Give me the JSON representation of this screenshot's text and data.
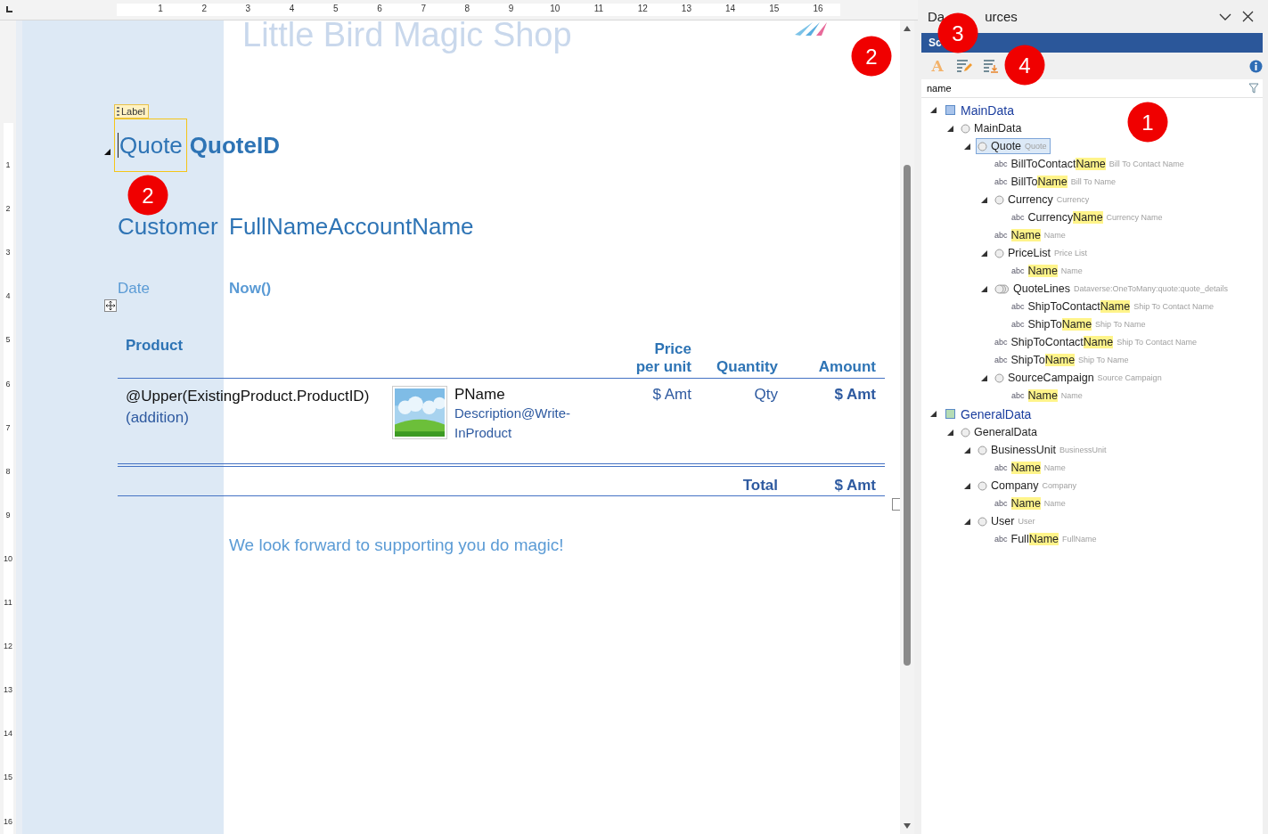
{
  "rulers": {
    "top_numbers": [
      "1",
      "2",
      "3",
      "4",
      "5",
      "6",
      "7",
      "8",
      "9",
      "10",
      "11",
      "12",
      "13",
      "14",
      "15",
      "16"
    ],
    "left_numbers": [
      "1",
      "2",
      "3",
      "4",
      "5",
      "6",
      "7",
      "8",
      "9",
      "10",
      "11",
      "12",
      "13",
      "14",
      "15",
      "16"
    ]
  },
  "document": {
    "banner": "Little Bird Magic Shop",
    "label_tag": "Label",
    "title_label": "Quote",
    "title_value": "QuoteID",
    "customer_label": "Customer",
    "customer_value": "FullNameAccountName",
    "date_label": "Date",
    "date_value": "Now()",
    "table": {
      "columns": [
        {
          "kind": "product",
          "label": "Product"
        },
        {
          "kind": "price",
          "label": "Price per unit"
        },
        {
          "kind": "quantity",
          "label": "Quantity"
        },
        {
          "kind": "amount",
          "label": "Amount"
        }
      ],
      "row": {
        "product": "@Upper(ExistingProduct.ProductID)",
        "addition": "(addition)",
        "name": "PName",
        "description": "Description@Write-InProduct",
        "price": "$ Amt",
        "quantity": "Qty",
        "amount": "$ Amt"
      },
      "total_label": "Total",
      "total_value": "$ Amt"
    },
    "footer": "We look forward to supporting you do magic!"
  },
  "panel": {
    "title_parts": [
      "Da",
      "urces"
    ],
    "tab_bar": "Sc",
    "toolbar": [
      {
        "kind": "font",
        "glyph": "A"
      },
      {
        "kind": "edit"
      },
      {
        "kind": "import"
      }
    ],
    "search": {
      "value": "name"
    },
    "tree": [
      {
        "kind": "source",
        "name": "MainData",
        "color": "#a9c4eb",
        "expanded": true,
        "selected": false,
        "children": [
          {
            "kind": "object",
            "name": "MainData",
            "expanded": true,
            "selected": false,
            "children": [
              {
                "kind": "object",
                "name": "Quote",
                "caption": "Quote",
                "expanded": true,
                "selected": true,
                "children": [
                  {
                    "kind": "field",
                    "type": "abc",
                    "name": "BillToContact",
                    "match": "Name",
                    "caption": "Bill To Contact Name",
                    "selected": false
                  },
                  {
                    "kind": "field",
                    "type": "abc",
                    "name": "BillTo",
                    "match": "Name",
                    "caption": "Bill To Name",
                    "selected": false
                  },
                  {
                    "kind": "object",
                    "name": "Currency",
                    "caption": "Currency",
                    "expanded": true,
                    "selected": false,
                    "children": [
                      {
                        "kind": "field",
                        "type": "abc",
                        "name": "Currency",
                        "match": "Name",
                        "caption": "Currency Name",
                        "selected": false
                      }
                    ]
                  },
                  {
                    "kind": "field",
                    "type": "abc",
                    "match": "Name",
                    "caption": "Name",
                    "selected": false
                  },
                  {
                    "kind": "object",
                    "name": "PriceList",
                    "caption": "Price List",
                    "expanded": true,
                    "selected": false,
                    "children": [
                      {
                        "kind": "field",
                        "type": "abc",
                        "match": "Name",
                        "caption": "Name",
                        "selected": false
                      }
                    ]
                  },
                  {
                    "kind": "collection",
                    "name": "QuoteLines",
                    "caption": "Dataverse:OneToMany:quote:quote_details",
                    "expanded": true,
                    "selected": false,
                    "children": [
                      {
                        "kind": "field",
                        "type": "abc",
                        "name": "ShipToContact",
                        "match": "Name",
                        "caption": "Ship To Contact Name",
                        "selected": false
                      },
                      {
                        "kind": "field",
                        "type": "abc",
                        "name": "ShipTo",
                        "match": "Name",
                        "caption": "Ship To Name",
                        "selected": false
                      }
                    ]
                  },
                  {
                    "kind": "field",
                    "type": "abc",
                    "name": "ShipToContact",
                    "match": "Name",
                    "caption": "Ship To Contact Name",
                    "selected": false
                  },
                  {
                    "kind": "field",
                    "type": "abc",
                    "name": "ShipTo",
                    "match": "Name",
                    "caption": "Ship To Name",
                    "selected": false
                  },
                  {
                    "kind": "object",
                    "name": "SourceCampaign",
                    "caption": "Source Campaign",
                    "expanded": true,
                    "selected": false,
                    "children": [
                      {
                        "kind": "field",
                        "type": "abc",
                        "match": "Name",
                        "caption": "Name",
                        "selected": false
                      }
                    ]
                  }
                ]
              }
            ]
          }
        ]
      },
      {
        "kind": "source",
        "name": "GeneralData",
        "color": "#b5dcb5",
        "expanded": true,
        "selected": false,
        "children": [
          {
            "kind": "object",
            "name": "GeneralData",
            "expanded": true,
            "selected": false,
            "children": [
              {
                "kind": "object",
                "name": "BusinessUnit",
                "caption": "BusinessUnit",
                "expanded": true,
                "selected": false,
                "children": [
                  {
                    "kind": "field",
                    "type": "abc",
                    "match": "Name",
                    "caption": "Name",
                    "selected": false
                  }
                ]
              },
              {
                "kind": "object",
                "name": "Company",
                "caption": "Company",
                "expanded": true,
                "selected": false,
                "children": [
                  {
                    "kind": "field",
                    "type": "abc",
                    "match": "Name",
                    "caption": "Name",
                    "selected": false
                  }
                ]
              },
              {
                "kind": "object",
                "name": "User",
                "caption": "User",
                "expanded": true,
                "selected": false,
                "children": [
                  {
                    "kind": "field",
                    "type": "abc",
                    "name": "Full",
                    "match": "Name",
                    "caption": "FullName",
                    "selected": false
                  }
                ]
              }
            ]
          }
        ]
      }
    ]
  },
  "badges": [
    "1",
    "2",
    "2",
    "3",
    "4"
  ]
}
